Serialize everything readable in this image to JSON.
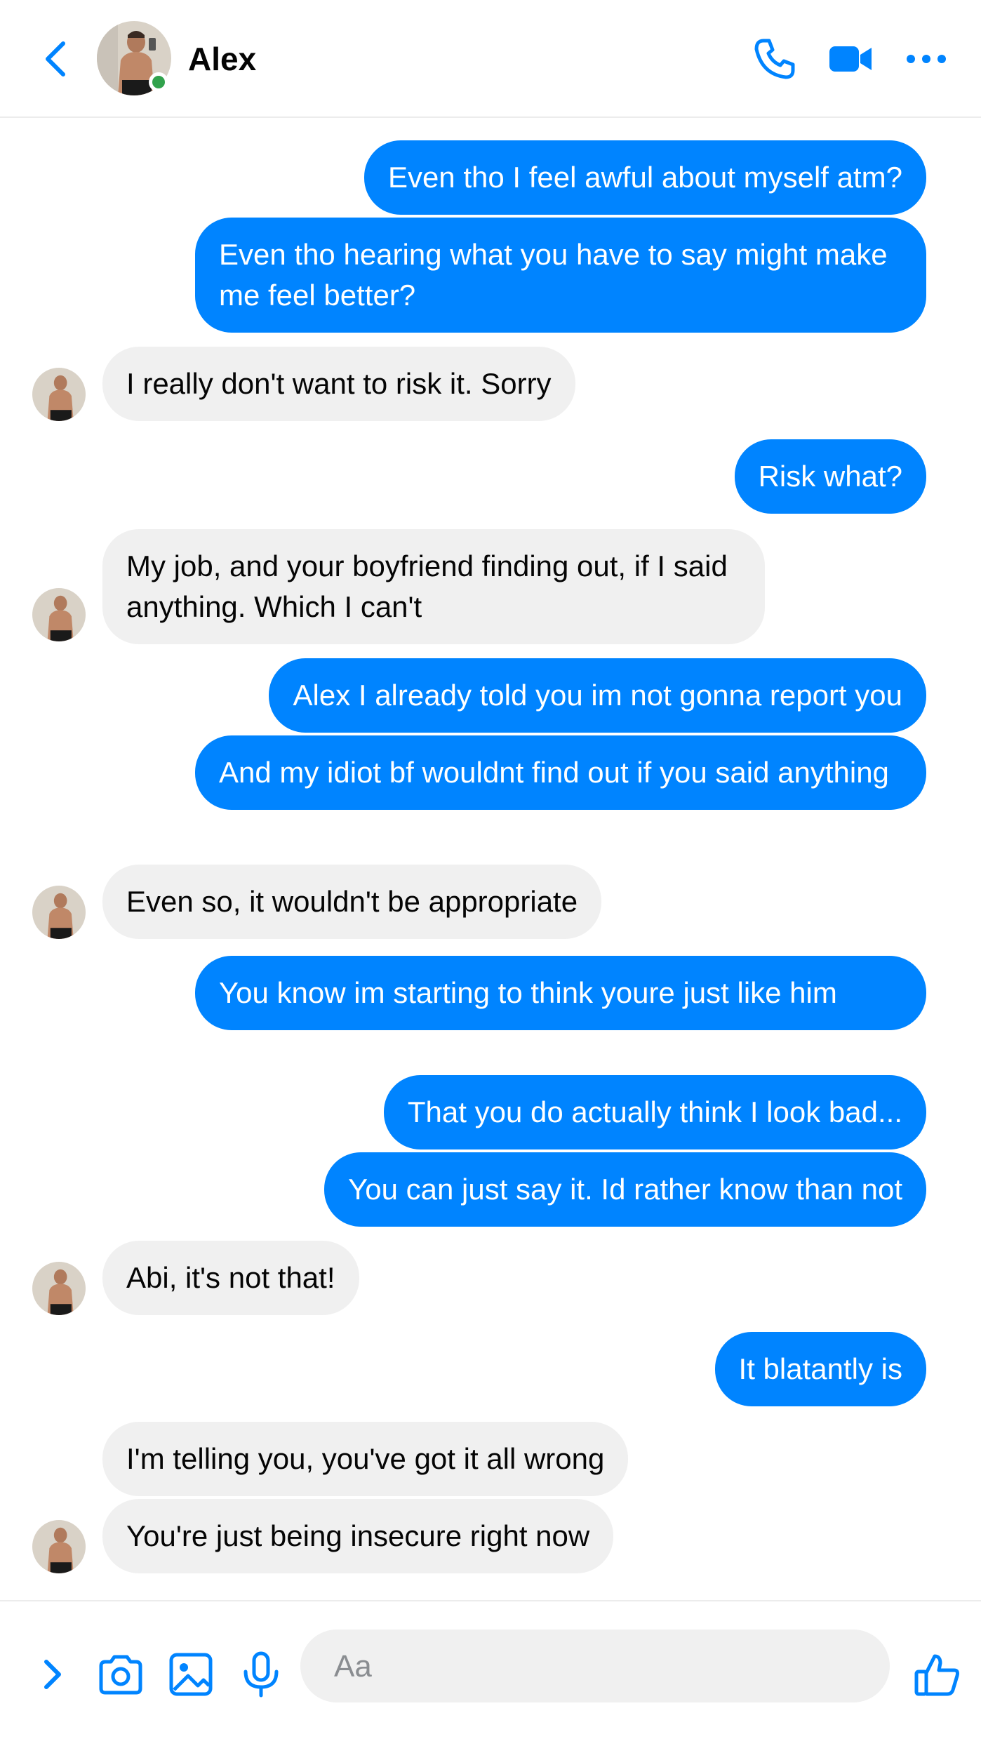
{
  "header": {
    "contact_name": "Alex",
    "online": true,
    "icons": [
      "back-icon",
      "phone-icon",
      "video-camera-icon",
      "more-icon"
    ]
  },
  "messages": [
    {
      "from": "me",
      "text": "Even tho I feel awful about myself atm?"
    },
    {
      "from": "me",
      "text": "Even tho hearing what you have to say might make me feel better?"
    },
    {
      "from": "them",
      "text": "I really don't want to risk it. Sorry"
    },
    {
      "from": "me",
      "text": "Risk what?"
    },
    {
      "from": "them",
      "text": "My job, and your boyfriend finding out, if I said anything. Which I can't"
    },
    {
      "from": "me",
      "text": "Alex I already told you im not gonna report you"
    },
    {
      "from": "me",
      "text": "And my idiot bf wouldnt find out if you said anything"
    },
    {
      "from": "them",
      "text": "Even so, it wouldn't be appropriate"
    },
    {
      "from": "me",
      "text": "You know im starting to think youre just like him"
    },
    {
      "from": "me",
      "text": "That you do actually think I look bad..."
    },
    {
      "from": "me",
      "text": "You can just say it. Id rather know than not"
    },
    {
      "from": "them",
      "text": "Abi, it's not that!"
    },
    {
      "from": "me",
      "text": "It blatantly is"
    },
    {
      "from": "them",
      "text": "I'm telling you, you've got it all wrong"
    },
    {
      "from": "them",
      "text": "You're just being insecure right now"
    }
  ],
  "composer": {
    "placeholder": "Aa",
    "value": "",
    "icons": [
      "expand-icon",
      "camera-icon",
      "gallery-icon",
      "microphone-icon",
      "thumbs-up-icon"
    ]
  },
  "colors": {
    "accent": "#0084ff",
    "incoming_bubble": "#f0f0f0",
    "online": "#31a24c"
  }
}
